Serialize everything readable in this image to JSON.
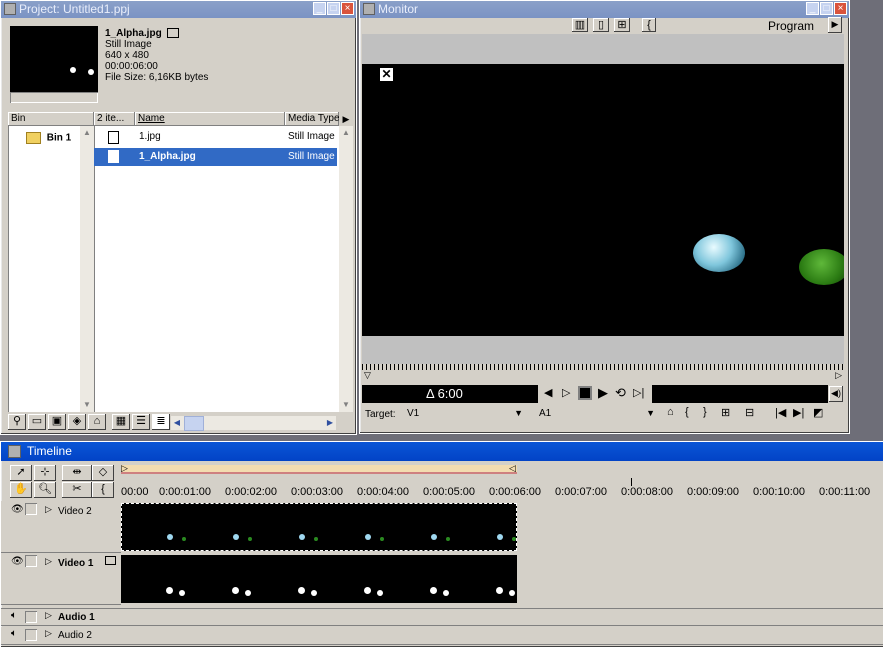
{
  "project": {
    "title": "Project: Untitled1.ppj",
    "clip_name": "1_Alpha.jpg",
    "clip_type": "Still Image",
    "clip_dims": "640 x 480",
    "clip_duration": "00:00:06:00",
    "clip_size": "File Size: 6,16KB bytes",
    "bin_header": "Bin",
    "count_header": "2 ite...",
    "name_header": "Name",
    "type_header": "Media Type",
    "bins": [
      {
        "label": "Bin 1"
      }
    ],
    "items": [
      {
        "name": "1.jpg",
        "type": "Still Image",
        "selected": false
      },
      {
        "name": "1_Alpha.jpg",
        "type": "Still Image",
        "selected": true
      }
    ]
  },
  "monitor": {
    "title": "Monitor",
    "view_label": "Program",
    "timecode": "Δ 6:00",
    "target_label": "Target:",
    "target_video": "V1",
    "target_audio": "A1"
  },
  "timeline": {
    "title": "Timeline",
    "ruler": [
      "00:00",
      "0:00:01:00",
      "0:00:02:00",
      "0:00:03:00",
      "0:00:04:00",
      "0:00:05:00",
      "0:00:06:00",
      "0:00:07:00",
      "0:00:08:00",
      "0:00:09:00",
      "0:00:10:00",
      "0:00:11:00"
    ],
    "tracks": [
      {
        "label": "Video 2"
      },
      {
        "label": "Video 1"
      },
      {
        "label": "Audio 1"
      },
      {
        "label": "Audio 2"
      }
    ]
  },
  "colors": {
    "accent": "#316ac5",
    "title_active": "#0a55d6",
    "title_inactive": "#7b93c4",
    "panel": "#d4d0c8",
    "in_out_bar": "#f3dcb0"
  },
  "icons": [
    "binoculars-icon",
    "folder-icon",
    "clipboard-icon",
    "trash-icon",
    "monitor-icon",
    "list-view-icon",
    "icon-view-icon",
    "play-icon",
    "stop-icon",
    "loop-icon",
    "step-forward-icon",
    "step-back-icon",
    "eye-icon",
    "speaker-icon",
    "arrow-tool-icon",
    "hand-tool-icon",
    "razor-tool-icon",
    "zoom-tool-icon"
  ]
}
